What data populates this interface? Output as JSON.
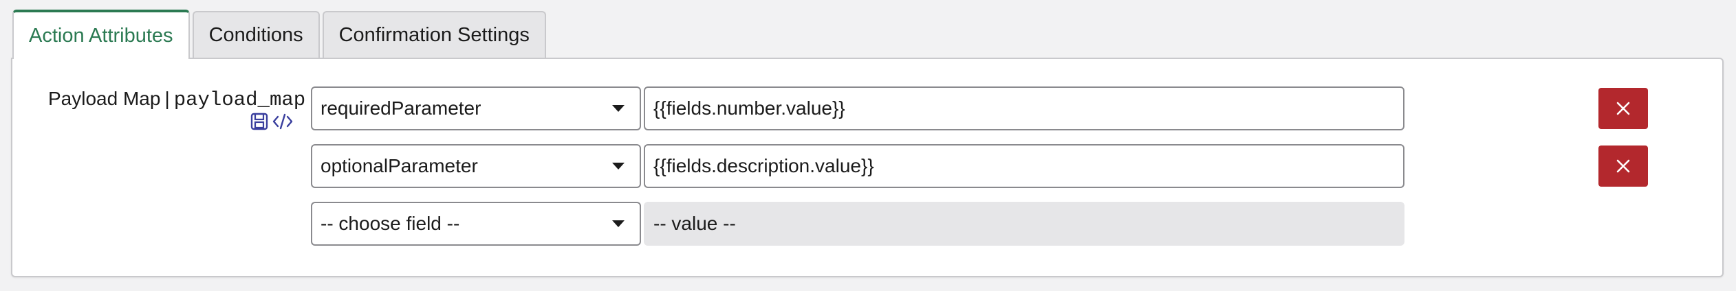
{
  "tabs": [
    {
      "label": "Action Attributes",
      "active": true
    },
    {
      "label": "Conditions",
      "active": false
    },
    {
      "label": "Confirmation Settings",
      "active": false
    }
  ],
  "field": {
    "label": "Payload Map",
    "separator": "|",
    "code_name": "payload_map",
    "icons": [
      "save-icon",
      "code-icon"
    ]
  },
  "rows": [
    {
      "field": "requiredParameter",
      "value": "{{fields.number.value}}"
    },
    {
      "field": "optionalParameter",
      "value": "{{fields.description.value}}"
    }
  ],
  "new_row": {
    "field_placeholder": "-- choose field --",
    "value_placeholder": "-- value --"
  },
  "colors": {
    "accent": "#2b7a52",
    "danger": "#b3282d",
    "icon": "#3a3f9e"
  }
}
